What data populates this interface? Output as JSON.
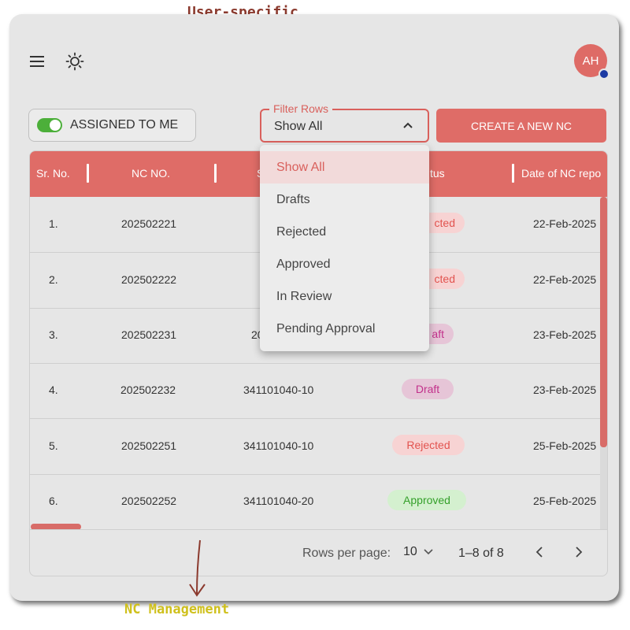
{
  "annotations": {
    "top": "User-specific\nTask Management",
    "bottom": "NC Management"
  },
  "header": {
    "menu_icon": "hamburger-menu-icon",
    "theme_icon": "sun-icon",
    "avatar_initials": "AH"
  },
  "toolbar": {
    "assigned_toggle_label": "ASSIGNED TO ME",
    "assigned_toggle_on": true,
    "filter_label": "Filter Rows",
    "filter_value": "Show All",
    "create_button_label": "CREATE A NEW NC"
  },
  "filter_options": [
    "Show All",
    "Drafts",
    "Rejected",
    "Approved",
    "In Review",
    "Pending Approval"
  ],
  "table": {
    "columns": [
      "Sr. No.",
      "NC NO.",
      "S",
      "tus",
      "Date of NC repo"
    ],
    "rows": [
      {
        "sr": "1.",
        "nc": "202502221",
        "col3": "",
        "status": "cted",
        "status_type": "rejected",
        "date": "22-Feb-2025"
      },
      {
        "sr": "2.",
        "nc": "202502222",
        "col3": "",
        "status": "cted",
        "status_type": "rejected",
        "date": "22-Feb-2025"
      },
      {
        "sr": "3.",
        "nc": "202502231",
        "col3": "20",
        "status": "aft",
        "status_type": "draft",
        "date": "23-Feb-2025"
      },
      {
        "sr": "4.",
        "nc": "202502232",
        "col3": "341101040-10",
        "status": "Draft",
        "status_type": "draft",
        "date": "23-Feb-2025"
      },
      {
        "sr": "5.",
        "nc": "202502251",
        "col3": "341101040-10",
        "status": "Rejected",
        "status_type": "rejected",
        "date": "25-Feb-2025"
      },
      {
        "sr": "6.",
        "nc": "202502252",
        "col3": "341101040-20",
        "status": "Approved",
        "status_type": "approved",
        "date": "25-Feb-2025"
      }
    ]
  },
  "pagination": {
    "rows_per_page_label": "Rows per page:",
    "rows_per_page_value": "10",
    "range_text": "1–8 of 8"
  },
  "colors": {
    "accent": "#df6c67",
    "draft": "#c2318b",
    "approved": "#34a02a",
    "toggle": "#4caf3a"
  }
}
